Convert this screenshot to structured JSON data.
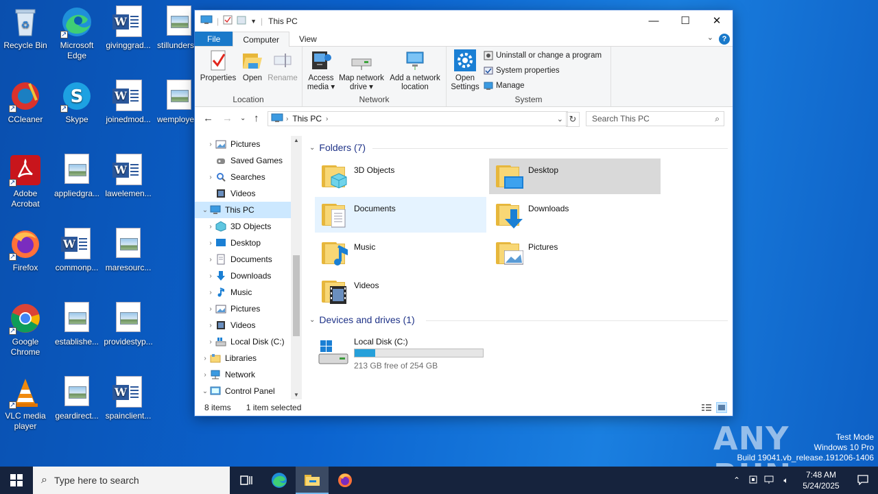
{
  "desktop": {
    "icons": [
      {
        "label": "Recycle Bin"
      },
      {
        "label": "Microsoft Edge"
      },
      {
        "label": "givinggrad..."
      },
      {
        "label": "stillunders..."
      },
      {
        "label": "CCleaner"
      },
      {
        "label": "Skype"
      },
      {
        "label": "joinedmod..."
      },
      {
        "label": "wemploye..."
      },
      {
        "label": "Adobe Acrobat"
      },
      {
        "label": "appliedgra..."
      },
      {
        "label": "lawelemen..."
      },
      {
        "label": "Firefox"
      },
      {
        "label": "commonp..."
      },
      {
        "label": "maresourc..."
      },
      {
        "label": "Google Chrome"
      },
      {
        "label": "establishe..."
      },
      {
        "label": "providestyp..."
      },
      {
        "label": "VLC media player"
      },
      {
        "label": "geardirect..."
      },
      {
        "label": "spainclient..."
      }
    ]
  },
  "window": {
    "title": "This PC",
    "tabs": {
      "file": "File",
      "computer": "Computer",
      "view": "View"
    },
    "help": "?",
    "ribbon": {
      "location": {
        "name": "Location",
        "properties": "Properties",
        "open": "Open",
        "rename": "Rename"
      },
      "network": {
        "name": "Network",
        "access_media": "Access media",
        "map_drive": "Map network drive",
        "add_location": "Add a network location"
      },
      "system": {
        "name": "System",
        "open_settings": "Open Settings",
        "uninstall": "Uninstall or change a program",
        "sys_props": "System properties",
        "manage": "Manage"
      }
    },
    "address": {
      "crumb": "This PC",
      "search_placeholder": "Search This PC"
    },
    "nav": [
      {
        "label": "Pictures"
      },
      {
        "label": "Saved Games"
      },
      {
        "label": "Searches"
      },
      {
        "label": "Videos"
      },
      {
        "label": "This PC"
      },
      {
        "label": "3D Objects"
      },
      {
        "label": "Desktop"
      },
      {
        "label": "Documents"
      },
      {
        "label": "Downloads"
      },
      {
        "label": "Music"
      },
      {
        "label": "Pictures"
      },
      {
        "label": "Videos"
      },
      {
        "label": "Local Disk (C:)"
      },
      {
        "label": "Libraries"
      },
      {
        "label": "Network"
      },
      {
        "label": "Control Panel"
      }
    ],
    "folders_header": "Folders (7)",
    "folders": [
      {
        "label": "3D Objects"
      },
      {
        "label": "Desktop"
      },
      {
        "label": "Documents"
      },
      {
        "label": "Downloads"
      },
      {
        "label": "Music"
      },
      {
        "label": "Pictures"
      },
      {
        "label": "Videos"
      }
    ],
    "devices_header": "Devices and drives (1)",
    "drive": {
      "label": "Local Disk (C:)",
      "free": "213 GB free of 254 GB",
      "used_fraction": 0.16
    },
    "status": {
      "items": "8 items",
      "selected": "1 item selected"
    }
  },
  "taskbar": {
    "search_placeholder": "Type here to search",
    "time": "7:48 AM",
    "date": "5/24/2025"
  },
  "watermark": {
    "line1": "Test Mode",
    "line2": "Windows 10 Pro",
    "line3": "Build 19041.vb_release.191206-1406",
    "brand": "ANY RUN"
  },
  "colors": {
    "accent": "#1979ca",
    "selection": "#cce8ff",
    "taskbar": "#16233d"
  }
}
